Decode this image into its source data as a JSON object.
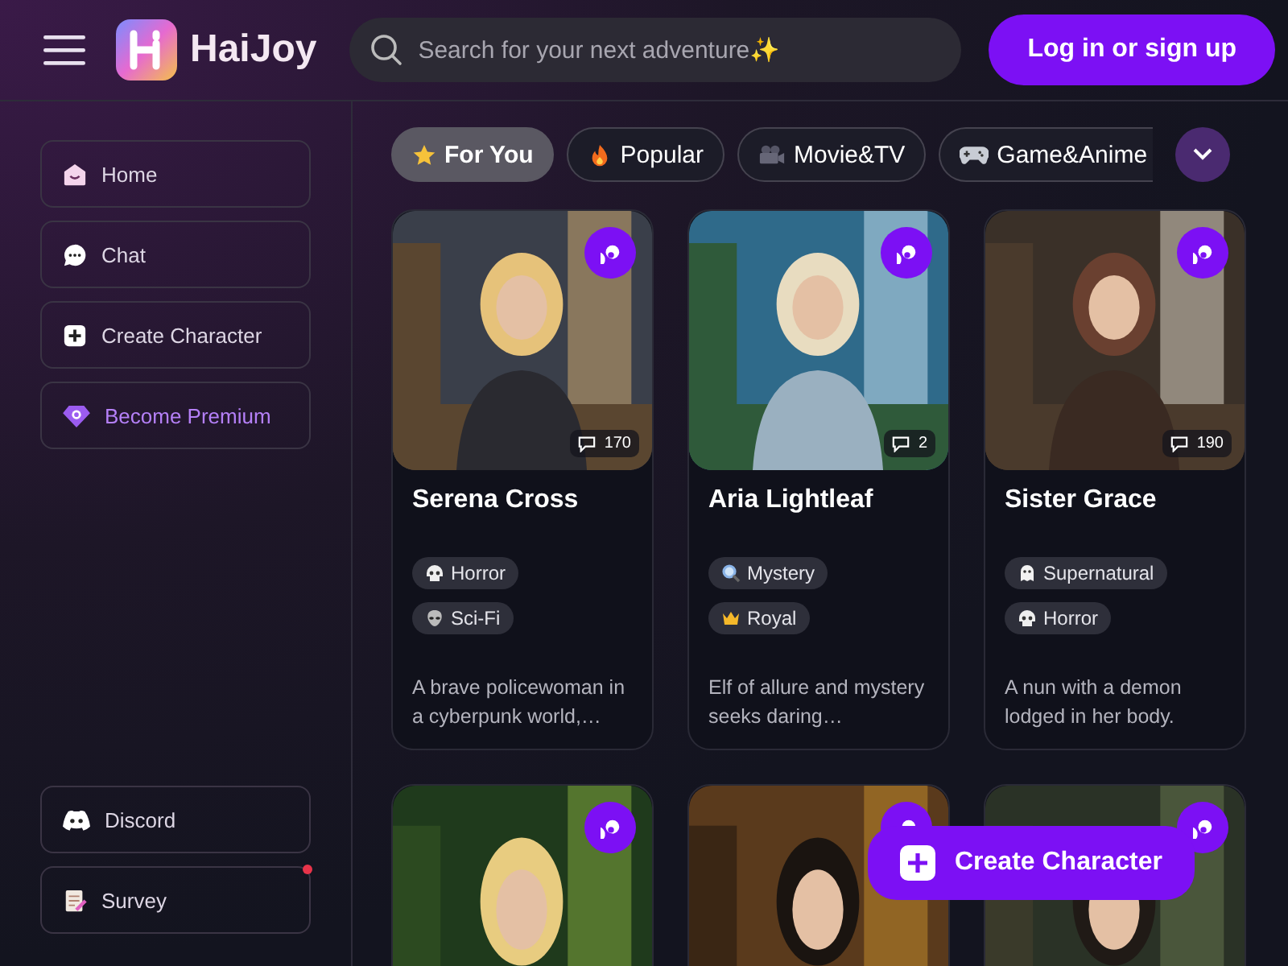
{
  "header": {
    "logo_text": "HaiJoy",
    "search": {
      "placeholder": "Search for your next adventure✨"
    },
    "login_button": "Log in or sign up"
  },
  "sidebar": {
    "items": [
      {
        "label": "Home",
        "kind": "home",
        "premium": false
      },
      {
        "label": "Chat",
        "kind": "chat",
        "premium": false
      },
      {
        "label": "Create Character",
        "kind": "create",
        "premium": false
      },
      {
        "label": "Become Premium",
        "kind": "premium",
        "premium": true
      }
    ],
    "bottom_items": [
      {
        "label": "Discord",
        "kind": "discord",
        "notification": false
      },
      {
        "label": "Survey",
        "kind": "survey",
        "notification": true
      }
    ]
  },
  "categories": [
    {
      "label": "For You",
      "kind": "star",
      "selected": true
    },
    {
      "label": "Popular",
      "kind": "fire",
      "selected": false
    },
    {
      "label": "Movie&TV",
      "kind": "camera",
      "selected": false
    },
    {
      "label": "Game&Anime",
      "kind": "gamepad",
      "selected": false
    }
  ],
  "cards": [
    {
      "name": "Serena Cross",
      "chats": "170",
      "tags": [
        {
          "label": "Horror",
          "kind": "skull"
        },
        {
          "label": "Sci-Fi",
          "kind": "alien"
        }
      ],
      "description": "A brave policewoman in a cyberpunk world,…"
    },
    {
      "name": "Aria Lightleaf",
      "chats": "2",
      "tags": [
        {
          "label": "Mystery",
          "kind": "magnifier"
        },
        {
          "label": "Royal",
          "kind": "crown"
        }
      ],
      "description": "Elf of allure and mystery seeks daring…"
    },
    {
      "name": "Sister Grace",
      "chats": "190",
      "tags": [
        {
          "label": "Supernatural",
          "kind": "ghost"
        },
        {
          "label": "Horror",
          "kind": "skull"
        }
      ],
      "description": "A nun with a demon lodged in her body."
    }
  ],
  "fab": {
    "label": "Create Character"
  }
}
